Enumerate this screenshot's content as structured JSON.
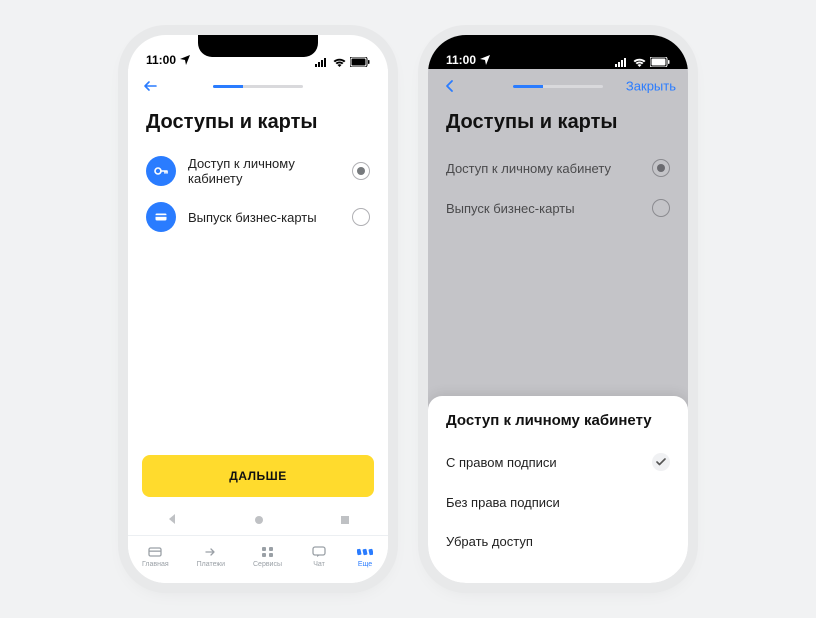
{
  "status": {
    "time": "11:00"
  },
  "progress": {
    "percent": 33
  },
  "topbar": {
    "close_label": "Закрыть"
  },
  "page": {
    "title": "Доступы и карты"
  },
  "options": [
    {
      "label": "Доступ к личному кабинету",
      "icon": "key-icon",
      "selected": true
    },
    {
      "label": "Выпуск бизнес-карты",
      "icon": "card-icon",
      "selected": false
    }
  ],
  "cta": {
    "label": "ДАЛЬШЕ"
  },
  "tabs": [
    {
      "label": "Главная"
    },
    {
      "label": "Платежи"
    },
    {
      "label": "Сервисы"
    },
    {
      "label": "Чат"
    },
    {
      "label": "Еще",
      "active": true
    }
  ],
  "sheet": {
    "title": "Доступ к личному кабинету",
    "items": [
      {
        "label": "С правом подписи",
        "checked": true
      },
      {
        "label": "Без права подписи",
        "checked": false
      },
      {
        "label": "Убрать доступ",
        "checked": false
      }
    ]
  }
}
